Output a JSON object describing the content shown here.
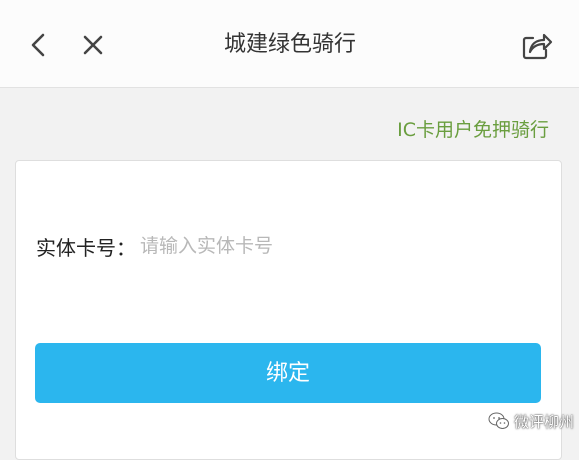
{
  "header": {
    "title": "城建绿色骑行",
    "back_icon": "chevron-left-icon",
    "close_icon": "close-icon",
    "share_icon": "share-icon"
  },
  "ic_link": {
    "label": "IC卡用户免押骑行",
    "color": "#6a9e3f"
  },
  "form": {
    "card_label": "实体卡号：",
    "card_input_value": "",
    "card_input_placeholder": "请输入实体卡号"
  },
  "bind_button": {
    "label": "绑定",
    "color": "#2bb6ee"
  },
  "watermark": {
    "text": "微评柳州"
  }
}
